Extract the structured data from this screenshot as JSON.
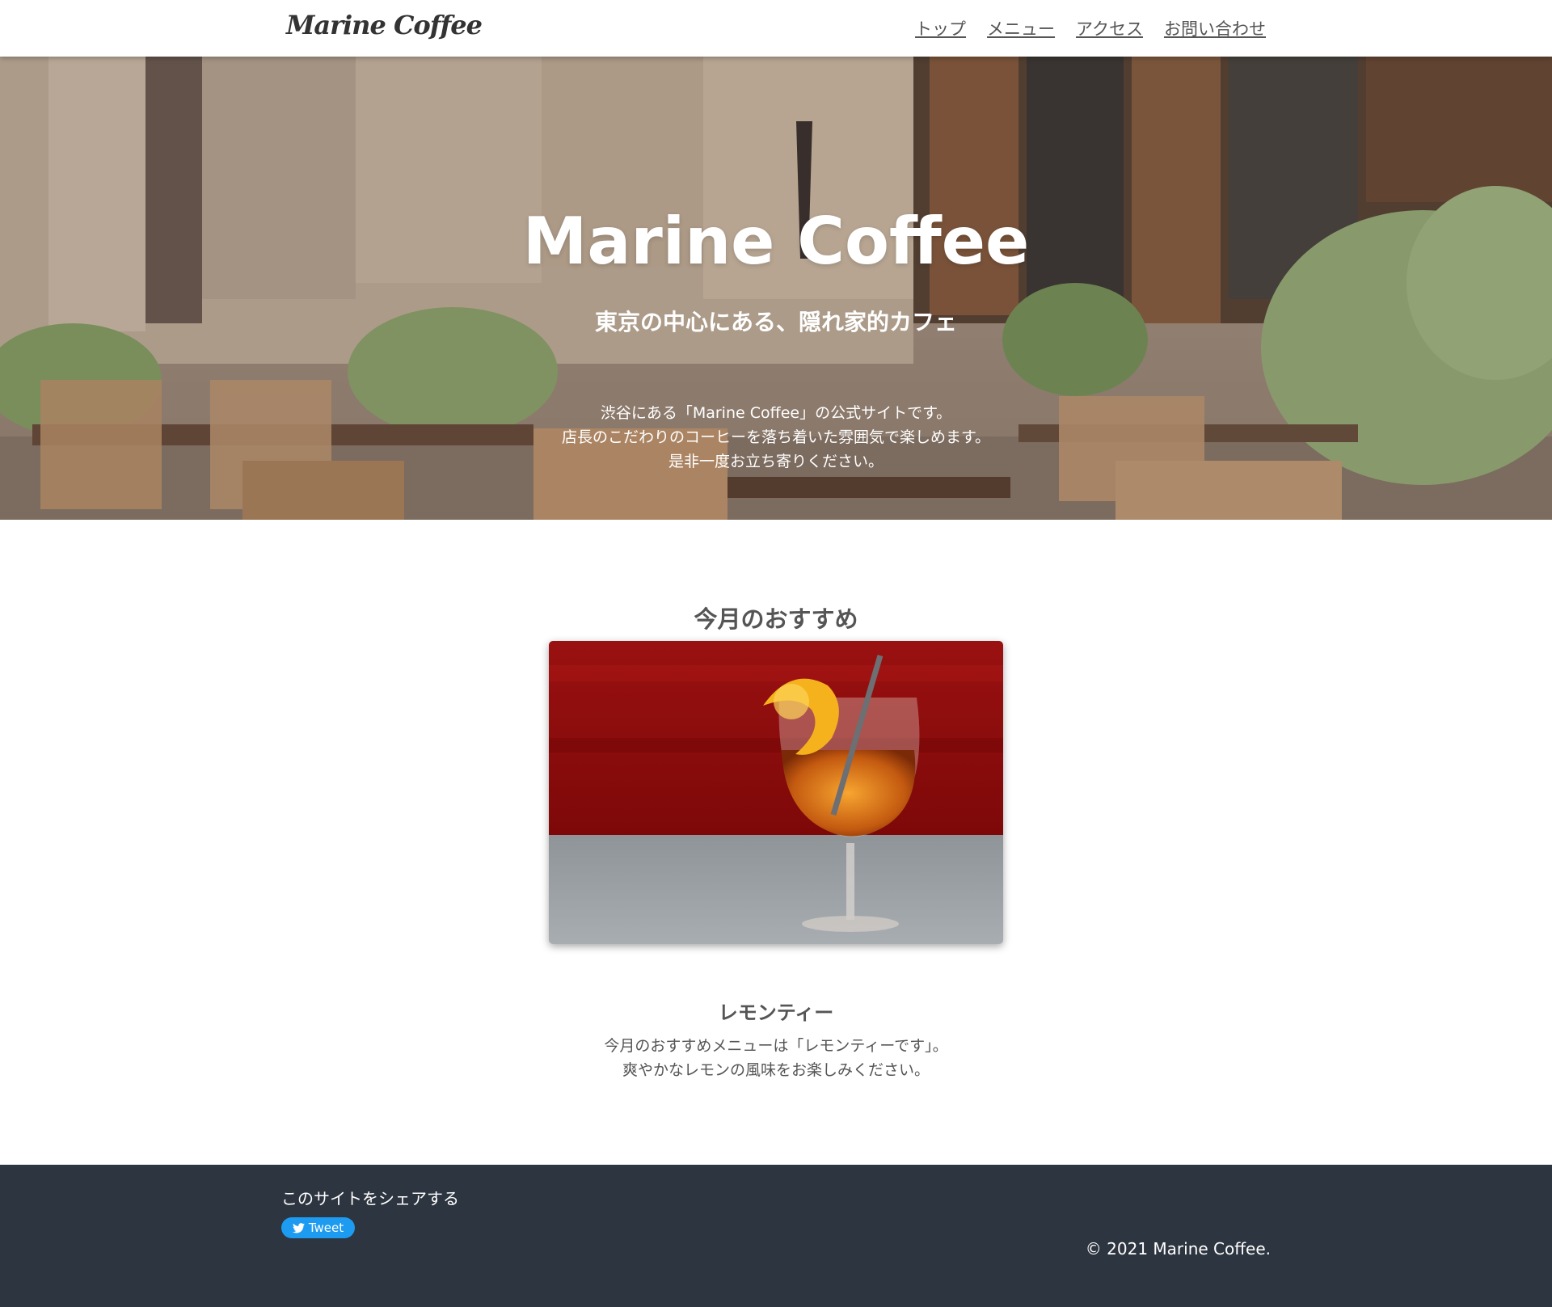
{
  "header": {
    "logo": "Marine Coffee",
    "nav": [
      "トップ",
      "メニュー",
      "アクセス",
      "お問い合わせ"
    ]
  },
  "hero": {
    "title": "Marine Coffee",
    "subtitle": "東京の中心にある、隠れ家的カフェ",
    "description": [
      "渋谷にある「Marine Coffee」の公式サイトです。",
      "店長のこだわりのコーヒーを落ち着いた雰囲気で楽しめます。",
      "是非一度お立ち寄りください。"
    ]
  },
  "recommend": {
    "title": "今月のおすすめ",
    "item_name": "レモンティー",
    "item_description": [
      "今月のおすすめメニューは「レモンティーです」。",
      "爽やかなレモンの風味をお楽しみください。"
    ]
  },
  "footer": {
    "share_label": "このサイトをシェアする",
    "tweet_label": "Tweet",
    "copyright": "© 2021 Marine Coffee."
  },
  "colors": {
    "footer_bg": "#2d3540",
    "text": "#555555",
    "tweet_button": "#1d9bf0"
  }
}
